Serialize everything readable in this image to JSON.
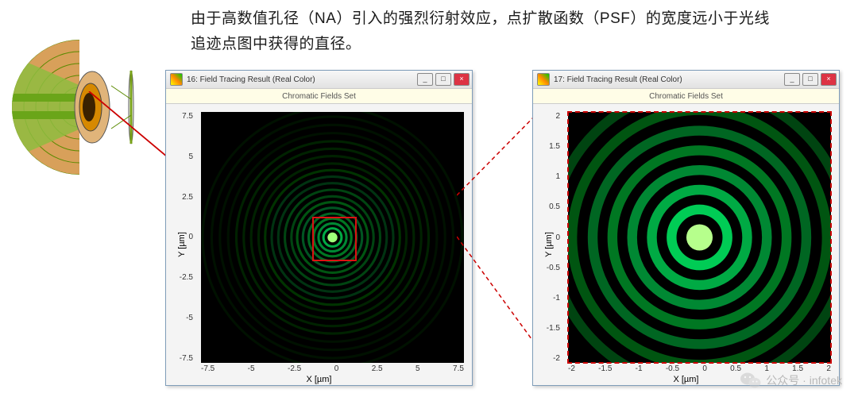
{
  "description": "由于高数值孔径（NA）引入的强烈衍射效应，点扩散函数（PSF）的宽度远小于光线追迹点图中获得的直径。",
  "window1": {
    "title": "16: Field Tracing Result (Real Color)",
    "subtitle": "Chromatic Fields Set",
    "xlabel": "X [µm]",
    "ylabel": "Y [µm]",
    "xticks": [
      "-7.5",
      "-5",
      "-2.5",
      "0",
      "2.5",
      "5",
      "7.5"
    ],
    "yticks": [
      "7.5",
      "5",
      "2.5",
      "0",
      "-2.5",
      "-5",
      "-7.5"
    ]
  },
  "window2": {
    "title": "17: Field Tracing Result (Real Color)",
    "subtitle": "Chromatic Fields Set",
    "xlabel": "X [µm]",
    "ylabel": "Y [µm]",
    "xticks": [
      "-2",
      "-1.5",
      "-1",
      "-0.5",
      "0",
      "0.5",
      "1",
      "1.5",
      "2"
    ],
    "yticks": [
      "2",
      "1.5",
      "1",
      "0.5",
      "0",
      "-0.5",
      "-1",
      "-1.5",
      "-2"
    ]
  },
  "buttons": {
    "min": "_",
    "max": "□",
    "close": "×"
  },
  "chart_data": {
    "type": "image",
    "panels": [
      {
        "id": "psf-full",
        "x_range_um": [
          -7.5,
          7.5
        ],
        "y_range_um": [
          -7.5,
          7.5
        ],
        "content": "Airy diffraction pattern (green), many concentric rings",
        "roi_um": {
          "x": [
            -1.2,
            1.2
          ],
          "y": [
            -1.2,
            1.2
          ]
        }
      },
      {
        "id": "psf-zoom",
        "x_range_um": [
          -2,
          2
        ],
        "y_range_um": [
          -2,
          2
        ],
        "content": "Zoomed Airy pattern center, central bright lobe + ~6 rings"
      }
    ]
  },
  "watermark": {
    "label": "公众号 · infotek"
  }
}
